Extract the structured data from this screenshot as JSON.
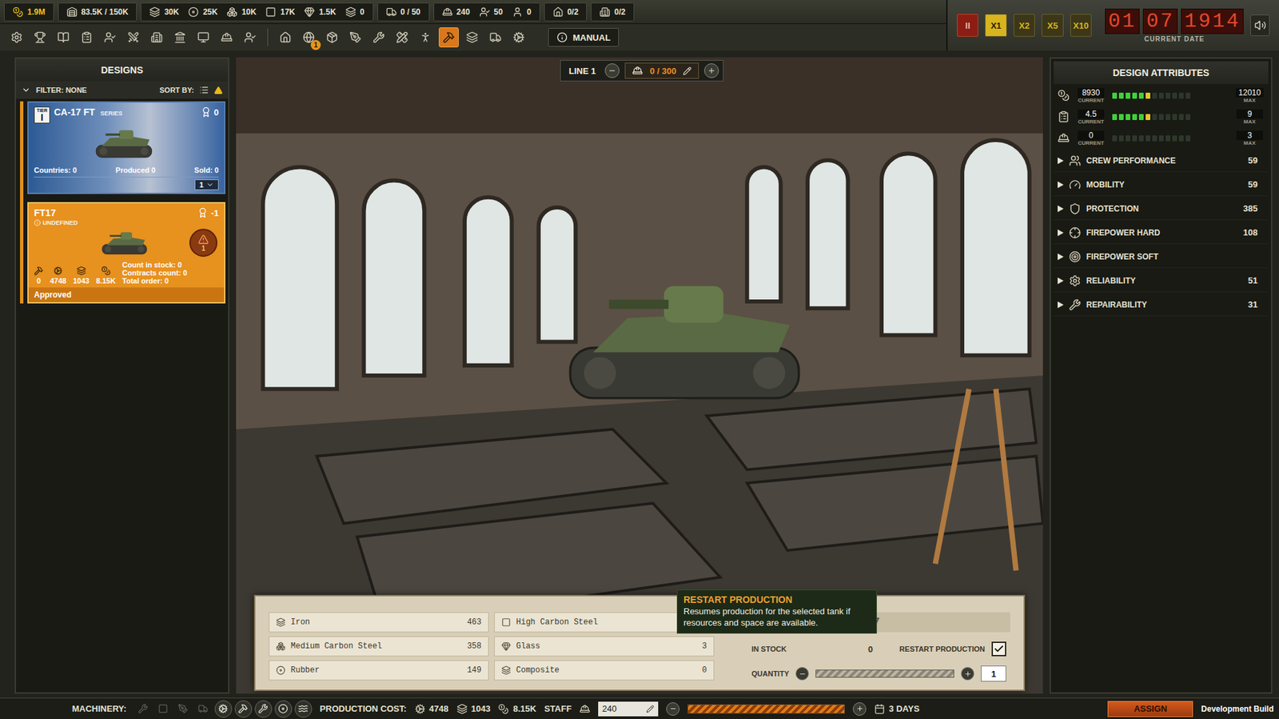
{
  "resource_groups": [
    [
      {
        "kind": "money",
        "value": "1.9M"
      }
    ],
    [
      {
        "kind": "storage",
        "value": "83.5K / 150K"
      }
    ],
    [
      {
        "kind": "steel",
        "value": "30K"
      },
      {
        "kind": "rubber",
        "value": "25K"
      },
      {
        "kind": "ingot",
        "value": "10K"
      },
      {
        "kind": "plate",
        "value": "17K"
      },
      {
        "kind": "glass",
        "value": "1.5K"
      },
      {
        "kind": "composite",
        "value": "0"
      }
    ],
    [
      {
        "kind": "vehicle",
        "value": "0 / 50"
      }
    ],
    [
      {
        "kind": "workers",
        "value": "240"
      },
      {
        "kind": "engineers",
        "value": "50"
      },
      {
        "kind": "idle",
        "value": "0"
      }
    ],
    [
      {
        "kind": "factory",
        "value": "0/2"
      }
    ],
    [
      {
        "kind": "office",
        "value": "0/2"
      }
    ]
  ],
  "toolbar": [
    [
      {
        "kind": "settings",
        "selected": false
      },
      {
        "kind": "trophy",
        "selected": false
      },
      {
        "kind": "ledger",
        "selected": false
      },
      {
        "kind": "contracts",
        "selected": false
      },
      {
        "kind": "staff",
        "selected": false
      },
      {
        "kind": "military",
        "selected": false
      },
      {
        "kind": "hr",
        "selected": false
      },
      {
        "kind": "bank",
        "selected": false
      },
      {
        "kind": "research",
        "selected": false
      },
      {
        "kind": "workers",
        "selected": false
      },
      {
        "kind": "engineers",
        "selected": false
      }
    ],
    [
      {
        "kind": "factory",
        "selected": false
      },
      {
        "kind": "globe",
        "selected": false,
        "badge": "1"
      },
      {
        "kind": "logistics",
        "selected": false
      },
      {
        "kind": "design",
        "selected": false
      },
      {
        "kind": "maintenance",
        "selected": false
      },
      {
        "kind": "blueprint",
        "selected": false
      },
      {
        "kind": "personnel",
        "selected": false
      },
      {
        "kind": "production",
        "selected": true
      },
      {
        "kind": "materials",
        "selected": false
      },
      {
        "kind": "vehicles",
        "selected": false
      },
      {
        "kind": "assembly",
        "selected": false
      }
    ]
  ],
  "manual_button": {
    "label": "MANUAL"
  },
  "speed_buttons": [
    {
      "label": "II",
      "kind": "pause",
      "selected": false
    },
    {
      "label": "X1",
      "kind": "speed",
      "selected": true
    },
    {
      "label": "X2",
      "kind": "speed",
      "selected": false
    },
    {
      "label": "X5",
      "kind": "speed",
      "selected": false
    },
    {
      "label": "X10",
      "kind": "speed",
      "selected": false
    }
  ],
  "date": {
    "parts": [
      "01",
      "07",
      "1914"
    ],
    "label": "CURRENT DATE"
  },
  "designs_panel": {
    "title": "DESIGNS",
    "filter": "FILTER: NONE",
    "sort_label": "SORT BY:",
    "cards": [
      {
        "kind": "series",
        "selected": false,
        "tier_label": "TIER",
        "tier": "I",
        "name": "CA-17 FT",
        "subtitle": "SERIES",
        "awards": "0",
        "stats": [
          "Countries: 0",
          "Produced 0",
          "Sold: 0"
        ],
        "dropdown": "1"
      },
      {
        "kind": "design",
        "selected": true,
        "name": "FT17",
        "subtitle": "UNDEFINED",
        "awards": "-1",
        "warning": "1",
        "costs": [
          {
            "kind": "hammer",
            "value": "0"
          },
          {
            "kind": "gear",
            "value": "4748"
          },
          {
            "kind": "steel",
            "value": "1043"
          },
          {
            "kind": "money",
            "value": "8.15K"
          }
        ],
        "counts": [
          "Count in stock: 0",
          "Contracts count: 0",
          "Total order: 0"
        ],
        "status": "Approved"
      }
    ]
  },
  "line_bar": {
    "label": "LINE 1",
    "workers": "0 / 300"
  },
  "production": {
    "resources": [
      {
        "kind": "steel",
        "name": "Iron",
        "value": "463"
      },
      {
        "kind": "ingot",
        "name": "Medium Carbon Steel",
        "value": "358"
      },
      {
        "kind": "rubber",
        "name": "Rubber",
        "value": "149"
      },
      {
        "kind": "plate",
        "name": "High Carbon Steel"
      },
      {
        "kind": "glass",
        "name": "Glass",
        "value": "3"
      },
      {
        "kind": "composite",
        "name": "Composite",
        "value": "0"
      }
    ],
    "title": "17",
    "in_stock_label": "IN STOCK",
    "in_stock": "0",
    "restart_label": "RESTART PRODUCTION",
    "restart_checked": true,
    "quantity_label": "QUANTITY",
    "quantity": "1",
    "quantity_level": 0
  },
  "tooltip": {
    "title": "RESTART PRODUCTION",
    "text": "Resumes production for the selected tank if resources and space are available."
  },
  "attributes_panel": {
    "title": "DESIGN ATTRIBUTES",
    "meters": [
      {
        "kind": "money",
        "current": "8930",
        "max": "12010",
        "level": 0.5,
        "current_label": "CURRENT",
        "max_label": "MAX"
      },
      {
        "kind": "contracts",
        "current": "4.5",
        "max": "9",
        "level": 0.5,
        "current_label": "CURRENT",
        "max_label": "MAX"
      },
      {
        "kind": "workers",
        "current": "0",
        "max": "3",
        "level": 0,
        "current_label": "CURRENT",
        "max_label": "MAX"
      }
    ],
    "rows": [
      {
        "kind": "crew",
        "label": "CREW PERFORMANCE",
        "value": "59",
        "expanded": false
      },
      {
        "kind": "mobility",
        "label": "MOBILITY",
        "value": "59",
        "expanded": false
      },
      {
        "kind": "protection",
        "label": "PROTECTION",
        "value": "385",
        "expanded": false
      },
      {
        "kind": "fire-hard",
        "label": "FIREPOWER HARD",
        "value": "108",
        "expanded": false
      },
      {
        "kind": "fire-soft",
        "label": "FIREPOWER SOFT",
        "expanded": false
      },
      {
        "kind": "reliability",
        "label": "RELIABILITY",
        "value": "51",
        "expanded": false
      },
      {
        "kind": "repair",
        "label": "REPAIRABILITY",
        "value": "31",
        "expanded": false
      }
    ]
  },
  "bottom_bar": {
    "machinery_label": "MACHINERY:",
    "machinery": [
      {
        "kind": "drill",
        "active": false
      },
      {
        "kind": "press",
        "active": false
      },
      {
        "kind": "welder",
        "active": false
      },
      {
        "kind": "crane",
        "active": false
      },
      {
        "kind": "lathe",
        "active": true
      },
      {
        "kind": "hammer",
        "active": true
      },
      {
        "kind": "drill",
        "active": true
      },
      {
        "kind": "disc",
        "active": true
      },
      {
        "kind": "wave",
        "active": true
      }
    ],
    "cost_label": "PRODUCTION COST:",
    "costs": [
      {
        "kind": "gear",
        "value": "4748"
      },
      {
        "kind": "steel",
        "value": "1043"
      },
      {
        "kind": "money",
        "value": "8.15K"
      }
    ],
    "staff_label": "STAFF",
    "staff": "240",
    "staff_level": 1,
    "duration": "3 DAYS",
    "assign": "ASSIGN",
    "build": "Development Build"
  }
}
